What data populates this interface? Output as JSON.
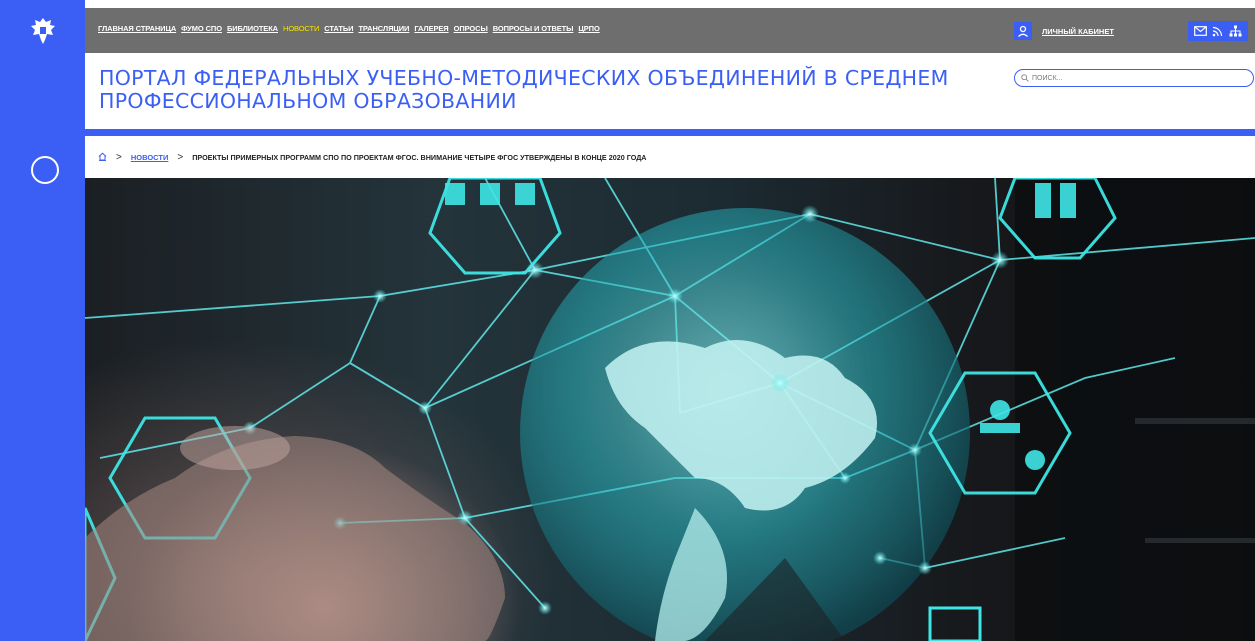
{
  "nav": {
    "items": [
      {
        "label": "ГЛАВНАЯ СТРАНИЦА",
        "active": false
      },
      {
        "label": "ФУМО СПО",
        "active": false
      },
      {
        "label": "БИБЛИОТЕКА",
        "active": false
      },
      {
        "label": "НОВОСТИ",
        "active": true
      },
      {
        "label": "СТАТЬИ",
        "active": false
      },
      {
        "label": "ТРАНСЛЯЦИИ",
        "active": false
      },
      {
        "label": "ГАЛЕРЕЯ",
        "active": false
      },
      {
        "label": "ОПРОСЫ",
        "active": false
      },
      {
        "label": "ВОПРОСЫ И ОТВЕТЫ",
        "active": false
      },
      {
        "label": "ЦРПО",
        "active": false
      }
    ],
    "account_label": "ЛИЧНЫЙ КАБИНЕТ",
    "tool_icons": [
      "mail-icon",
      "rss-icon",
      "sitemap-icon"
    ]
  },
  "header": {
    "title": "ПОРТАЛ ФЕДЕРАЛЬНЫХ УЧЕБНО-МЕТОДИЧЕСКИХ ОБЪЕДИНЕНИЙ В СРЕДНЕМ ПРОФЕССИОНАЛЬНОМ ОБРАЗОВАНИИ"
  },
  "search": {
    "placeholder": "ПОИСК..."
  },
  "breadcrumb": {
    "home_icon": "home-icon",
    "separator": ">",
    "section": "НОВОСТИ",
    "current": "ПРОЕКТЫ ПРИМЕРНЫХ ПРОГРАММ СПО ПО ПРОЕКТАМ ФГОС. ВНИМАНИЕ ЧЕТЫРЕ ФГОС УТВЕРЖДЕНЫ В КОНЦЕ 2020 ГОДА"
  },
  "colors": {
    "brand_blue": "#3b5ff5",
    "nav_gray": "#6e6e6e",
    "active_nav": "#f6e600",
    "accent_cyan": "#3ee6e6"
  }
}
